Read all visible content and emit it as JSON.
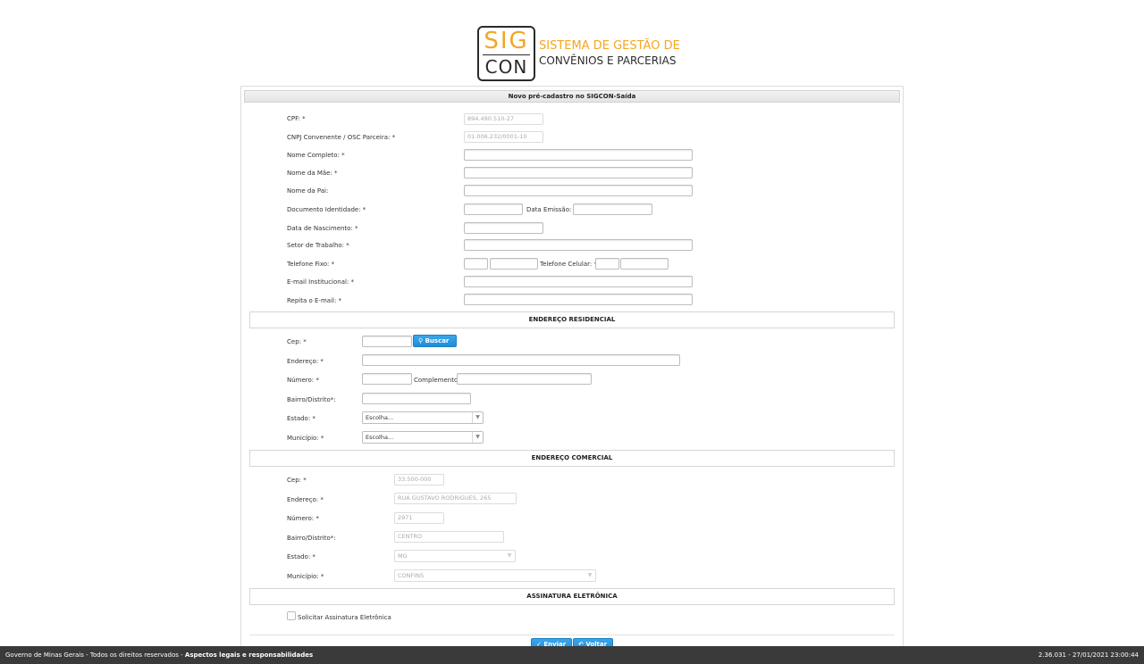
{
  "header": {
    "logo_top": "SIG",
    "logo_bottom": "CON",
    "system_line1": "SISTEMA DE GESTÃO DE",
    "system_line2": "CONVÊNIOS E PARCERIAS"
  },
  "form": {
    "title": "Novo pré-cadastro no SIGCON-Saída",
    "personal": {
      "cpf_label": "CPF: *",
      "cpf_value": "894.490.510-27",
      "cnpj_label": "CNPJ Convenente / OSC Parceira: *",
      "cnpj_value": "01.006.232/0001-10",
      "nome_label": "Nome Completo: *",
      "mae_label": "Nome da Mãe: *",
      "pai_label": "Nome da Pai:",
      "doc_label": "Documento Identidade: *",
      "emissao_label": "Data Emissão: *",
      "nascimento_label": "Data de Nascimento: *",
      "setor_label": "Setor de Trabalho: *",
      "telefone_label": "Telefone Fixo: *",
      "celular_label": "Telefone Celular: *",
      "email_label": "E-mail Institucional: *",
      "repita_email_label": "Repita o E-mail: *"
    },
    "residencial": {
      "header": "ENDEREÇO RESIDENCIAL",
      "cep_label": "Cep: *",
      "buscar_label": "Buscar",
      "endereco_label": "Endereço: *",
      "numero_label": "Número: *",
      "complemento_label": "Complemento:",
      "bairro_label": "Bairro/Distrito*:",
      "estado_label": "Estado: *",
      "estado_value": "Escolha...",
      "municipio_label": "Município: *",
      "municipio_value": "Escolha..."
    },
    "comercial": {
      "header": "ENDEREÇO COMERCIAL",
      "cep_label": "Cep: *",
      "cep_value": "33.500-000",
      "endereco_label": "Endereço: *",
      "endereco_value": "RUA GUSTAVO RODRIGUES, 265",
      "numero_label": "Número: *",
      "numero_value": "2971",
      "bairro_label": "Bairro/Distrito*:",
      "bairro_value": "CENTRO",
      "estado_label": "Estado: *",
      "estado_value": "MG",
      "municipio_label": "Município: *",
      "municipio_value": "CONFINS"
    },
    "assinatura": {
      "header": "ASSINATURA ELETRÔNICA",
      "checkbox_label": "Solicitar Assinatura Eletrônica"
    },
    "actions": {
      "enviar_label": "Enviar",
      "voltar_label": "Voltar"
    }
  },
  "footer": {
    "left_text": "Governo de Minas Gerais - Todos os direitos reservados - ",
    "left_link": "Aspectos legais e responsabilidades",
    "version": "2.36.031 - 27/01/2021 23:00:44"
  },
  "colors": {
    "brand_orange": "#f3a623",
    "button_blue": "#1f8ed8",
    "footer_bg": "#3a3a3a"
  }
}
